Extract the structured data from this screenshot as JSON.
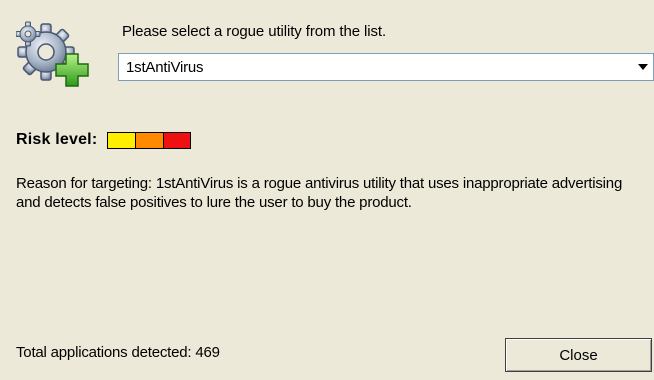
{
  "header": {
    "prompt": "Please select a rogue utility from the list.",
    "icon": "gear-plus-icon"
  },
  "select": {
    "value": "1stAntiVirus",
    "arrow_icon": "chevron-down-icon"
  },
  "risk": {
    "label": "Risk level:",
    "level": 3,
    "max_level": 3,
    "colors": [
      "#ffee00",
      "#ff8a00",
      "#ee1111"
    ]
  },
  "reason": "Reason for targeting: 1stAntiVirus is a rogue antivirus utility that uses inappropriate advertising and detects false positives to lure the user to buy the product.",
  "footer": {
    "total_text": "Total applications detected: 469",
    "close_label": "Close"
  }
}
